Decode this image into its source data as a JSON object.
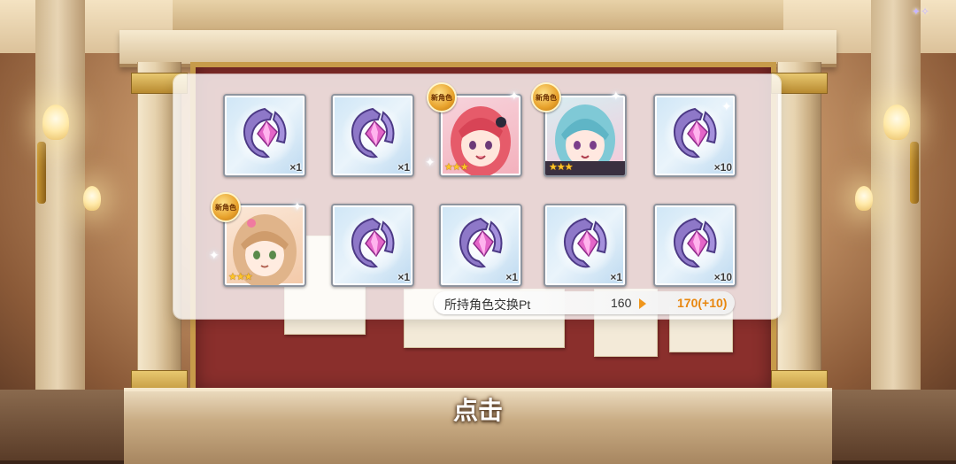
{
  "rewards": [
    {
      "type": "item",
      "name": "crystal-amulet",
      "qty": "×1"
    },
    {
      "type": "item",
      "name": "crystal-amulet",
      "qty": "×1"
    },
    {
      "type": "character",
      "variant": "red-hair",
      "badge": "新角色",
      "stars": "★★★"
    },
    {
      "type": "character",
      "variant": "blue-hair",
      "badge": "新角色",
      "stars": "★★★"
    },
    {
      "type": "item",
      "name": "crystal-amulet",
      "qty": "×10"
    },
    {
      "type": "character",
      "variant": "blonde-hair",
      "badge": "新角色",
      "stars": "★★★"
    },
    {
      "type": "item",
      "name": "crystal-amulet",
      "qty": "×1"
    },
    {
      "type": "item",
      "name": "crystal-amulet",
      "qty": "×1"
    },
    {
      "type": "item",
      "name": "crystal-amulet",
      "qty": "×1"
    },
    {
      "type": "item",
      "name": "crystal-amulet",
      "qty": "×10"
    }
  ],
  "points": {
    "label": "所持角色交换Pt",
    "old": "160",
    "new": "170(+10)"
  },
  "prompt": {
    "tap_label": "点击"
  },
  "colors": {
    "accent": "#e8870f",
    "board": "#8a2f2c",
    "gold": "#c79b4a"
  },
  "icons": {
    "arrow": "arrow-right-icon",
    "amulet": "crystal-amulet-icon",
    "badge": "new-character-badge"
  }
}
